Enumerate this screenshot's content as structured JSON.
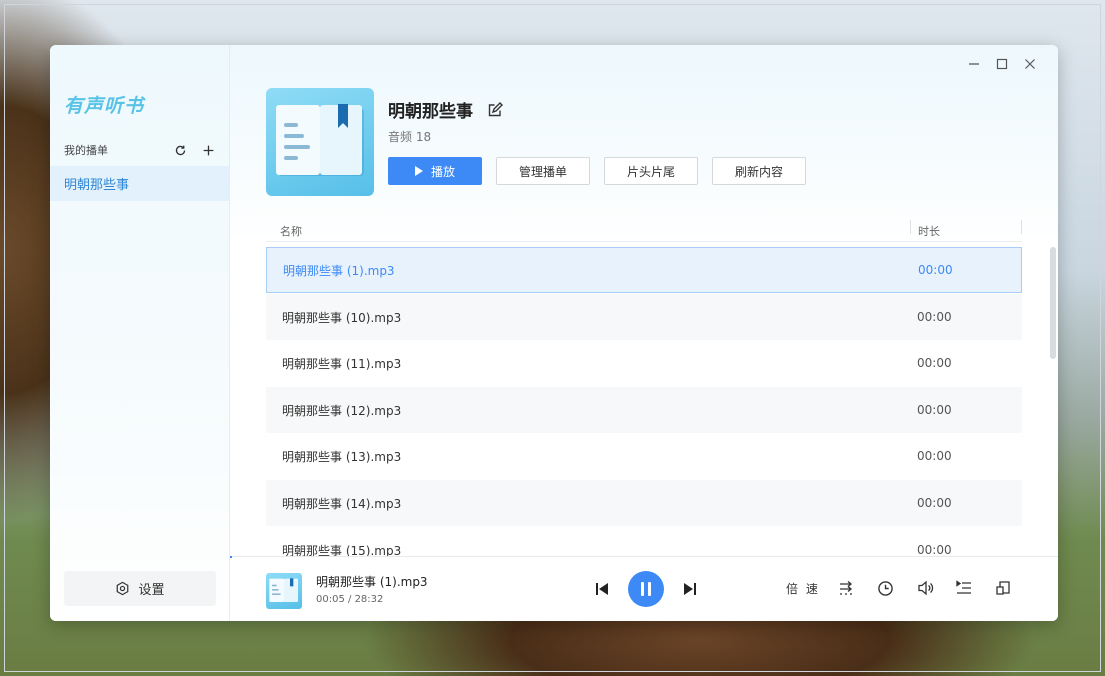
{
  "app": {
    "logo_text": "有声听书",
    "window_controls": [
      "minimize-icon",
      "maximize-icon",
      "close-icon"
    ]
  },
  "sidebar": {
    "section_label": "我的播单",
    "playlists": [
      {
        "label": "明朝那些事",
        "selected": true
      }
    ],
    "settings_label": "设置"
  },
  "book": {
    "title": "明朝那些事",
    "count_text": "音频 18",
    "actions": {
      "play_label": "播放",
      "manage_label": "管理播单",
      "intro_outro_label": "片头片尾",
      "refresh_label": "刷新内容"
    }
  },
  "table": {
    "columns": {
      "name": "名称",
      "duration": "时长"
    },
    "rows": [
      {
        "name": "明朝那些事 (1).mp3",
        "duration": "00:00",
        "active": true
      },
      {
        "name": "明朝那些事 (10).mp3",
        "duration": "00:00"
      },
      {
        "name": "明朝那些事 (11).mp3",
        "duration": "00:00"
      },
      {
        "name": "明朝那些事 (12).mp3",
        "duration": "00:00"
      },
      {
        "name": "明朝那些事 (13).mp3",
        "duration": "00:00"
      },
      {
        "name": "明朝那些事 (14).mp3",
        "duration": "00:00"
      },
      {
        "name": "明朝那些事 (15).mp3",
        "duration": "00:00"
      }
    ]
  },
  "player": {
    "now_playing_title": "明朝那些事 (1).mp3",
    "elapsed": "00:05",
    "separator": " / ",
    "total": "28:32",
    "progress": 0.003,
    "speed_label": "倍 速",
    "state": "playing"
  },
  "colors": {
    "accent": "#3d8af7",
    "logo": "#59c3e6",
    "active_row_bg": "#e8f2fd"
  }
}
